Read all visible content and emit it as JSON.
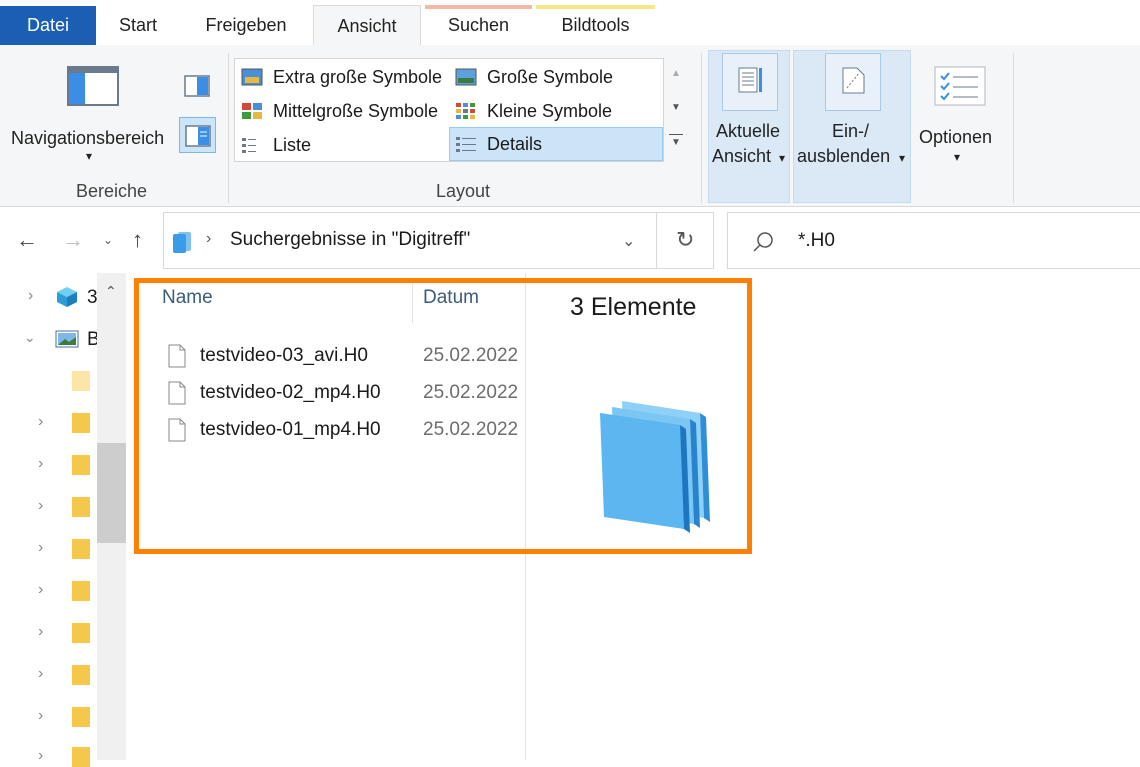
{
  "tabs": {
    "file": "Datei",
    "start": "Start",
    "share": "Freigeben",
    "view": "Ansicht",
    "search": "Suchen",
    "picture_tools": "Bildtools"
  },
  "ribbon": {
    "panes": {
      "label": "Bereiche",
      "nav_pane": "Navigationsbereich"
    },
    "layout": {
      "label": "Layout",
      "items": [
        "Extra große Symbole",
        "Große Symbole",
        "Mittelgroße Symbole",
        "Kleine Symbole",
        "Liste",
        "Details"
      ],
      "selected": "Details"
    },
    "current_view": {
      "line1": "Aktuelle",
      "line2": "Ansicht"
    },
    "show_hide": {
      "line1": "Ein-/",
      "line2": "ausblenden"
    },
    "options": "Optionen"
  },
  "address": {
    "text": "Suchergebnisse in \"Digitreff\"",
    "search_value": "*.H0"
  },
  "nav_pane": {
    "item1": "3",
    "item2": "B"
  },
  "content": {
    "columns": [
      "Name",
      "Datum"
    ],
    "rows": [
      {
        "name": "testvideo-03_avi.H0",
        "date": "25.02.2022"
      },
      {
        "name": "testvideo-02_mp4.H0",
        "date": "25.02.2022"
      },
      {
        "name": "testvideo-01_mp4.H0",
        "date": "25.02.2022"
      }
    ],
    "preview_title": "3 Elemente"
  },
  "colors": {
    "accent": "#1a5fb4",
    "highlight": "#ff8000",
    "selection": "#cce4f7",
    "search_tab_strip": "#f2b8a0",
    "picture_tab_strip": "#f5e887"
  }
}
